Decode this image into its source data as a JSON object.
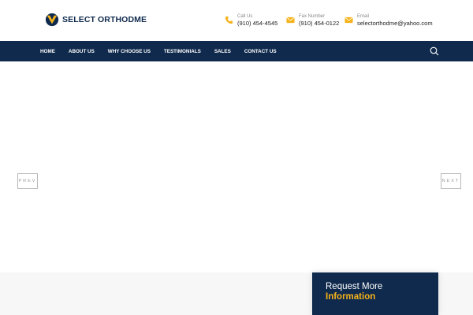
{
  "brand": {
    "name": "SELECT ORTHODME"
  },
  "contacts": [
    {
      "label": "Call Us",
      "value": "(910) 454-4545",
      "icon": "phone-icon"
    },
    {
      "label": "Fax Number",
      "value": "(910) 454-0122",
      "icon": "envelope-icon"
    },
    {
      "label": "Email",
      "value": "selectorthodme@yahoo.com",
      "icon": "envelope-icon"
    }
  ],
  "nav": {
    "items": [
      "HOME",
      "ABOUT US",
      "WHY CHOOSE US",
      "TESTIMONIALS",
      "SALES",
      "CONTACT US"
    ],
    "search_icon": "search-icon"
  },
  "slider": {
    "prev_label": "PREV",
    "next_label": "NEXT"
  },
  "request": {
    "line1": "Request More",
    "line2": "Information"
  },
  "colors": {
    "navy": "#0f2a4d",
    "accent": "#f5b21a"
  }
}
